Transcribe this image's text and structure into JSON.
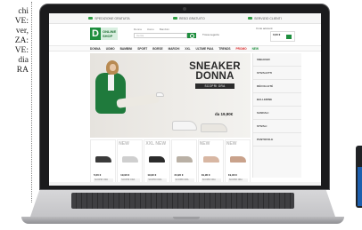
{
  "magazine": {
    "lines": [
      "chi",
      "VE:",
      "ver,",
      "ZA:",
      "VE:",
      "dia",
      "RA"
    ]
  },
  "site": {
    "topbar": [
      {
        "icon": "truck-icon",
        "text": "SPEDIZIONE GRATUITA"
      },
      {
        "icon": "return-icon",
        "text": "RESO GRATUITO"
      },
      {
        "icon": "phone-icon",
        "text": "SERVIZIO CLIENTI"
      }
    ],
    "logo": {
      "letter": "D",
      "line1": "ONLINE",
      "line2": "SHOP"
    },
    "subnav": [
      "Donna",
      "Uomo",
      "Bambini"
    ],
    "search_placeholder": "Cerca",
    "stores_label": "Trova negozio",
    "account_label": "Il mio account",
    "cart_label": "0,00 €",
    "categories": [
      "DONNA",
      "UOMO",
      "BAMBINI",
      "SPORT",
      "BORSE",
      "MARCHI",
      "XXL",
      "ULTIME PAIA",
      "TRENDS",
      "PROMO",
      "NEW"
    ],
    "sale_category": "PROMO",
    "new_category": "NEW",
    "hero": {
      "title_line1": "SNEAKER",
      "title_line2": "DONNA",
      "cta": "SCOPRI ORA",
      "price": "da 19,90€"
    },
    "sidebar": [
      "SNEAKER",
      "STIVALETTI",
      "DÉCOLLETÉ",
      "BALLERINE",
      "SANDALI",
      "STIVALI",
      "PANTOFOLE"
    ],
    "products": [
      {
        "tag": "",
        "price": "5,00 €",
        "btn": "SCOPRI ORA",
        "color": "#3a3a3a"
      },
      {
        "tag": "NEW",
        "price": "19,90 €",
        "btn": "SCOPRI ORA",
        "color": "#cfcfcf"
      },
      {
        "tag": "XXL NEW",
        "price": "19,90 €",
        "btn": "SCOPRI ORA",
        "color": "#2b2b2b"
      },
      {
        "tag": "",
        "price": "24,90 €",
        "btn": "SCOPRI ORA",
        "color": "#b9b0a5"
      },
      {
        "tag": "NEW",
        "price": "19,90 €",
        "btn": "SCOPRI ORA",
        "color": "#d8b7a3"
      },
      {
        "tag": "NEW",
        "price": "19,90 €",
        "btn": "SCOPRI ORA",
        "color": "#c9a28b"
      }
    ]
  },
  "colors": {
    "brand": "#1e8e3e",
    "sale": "#d92b2b",
    "device_blue": "#1d5fae"
  }
}
